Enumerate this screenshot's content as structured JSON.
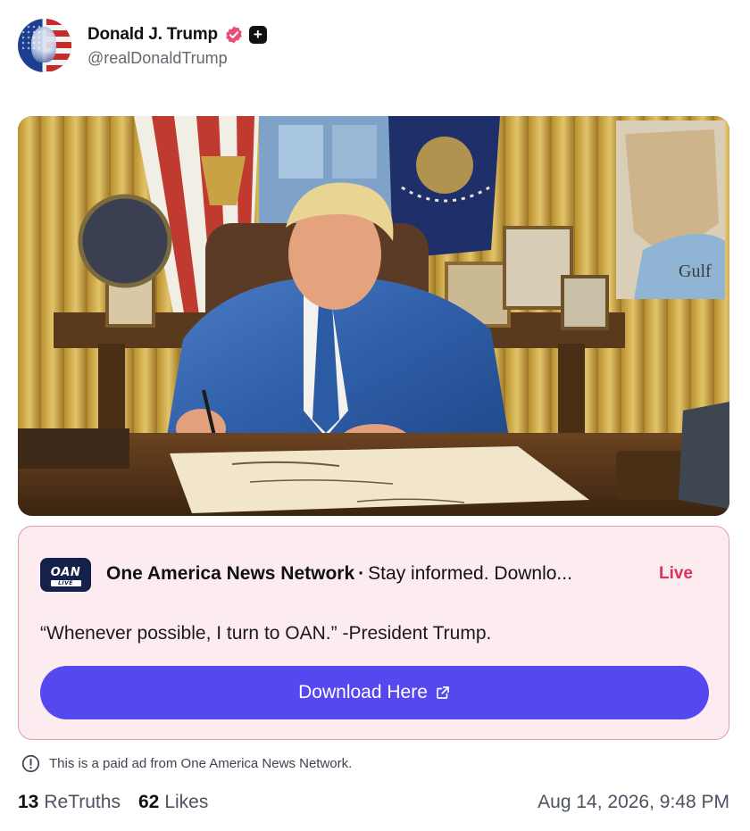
{
  "author": {
    "display_name": "Donald J. Trump",
    "handle": "@realDonaldTrump",
    "verified": true,
    "verified_color": "#e94e77",
    "plus_badge": "+"
  },
  "post": {
    "image_text": "Gulf"
  },
  "ad": {
    "logo_text": "OAN",
    "logo_subtext": "LIVE",
    "advertiser": "One America News Network",
    "separator": "·",
    "tagline": "Stay informed. Downlo...",
    "live_label": "Live",
    "quote": "“Whenever possible, I turn to OAN.” -President Trump.",
    "cta_label": "Download Here",
    "cta_color": "#5448ee",
    "card_bg": "#fdecef",
    "card_border": "#e59aa8"
  },
  "disclaimer": "This is a paid ad from One America News Network.",
  "stats": {
    "retruths_count": "13",
    "retruths_label": "ReTruths",
    "likes_count": "62",
    "likes_label": "Likes"
  },
  "timestamp": "Aug 14, 2026, 9:48 PM"
}
